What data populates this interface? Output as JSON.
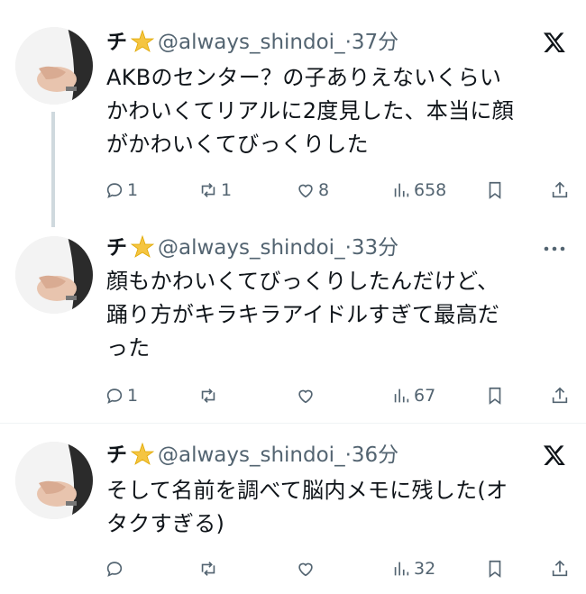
{
  "tweets": [
    {
      "name": "チ",
      "handle": "@always_shindoi_",
      "sep": "·",
      "time": "37分",
      "corner_icon": "x-logo-icon",
      "text": "AKBのセンター？の子ありえないくらいかわいくてリアルに2度見した、本当に顔がかわいくてびっくりした",
      "lines": [
        "AKBのセンター？の子ありえないくらい",
        "かわいくてリアルに2度見した、本当に顔",
        "がかわいくてびっくりした"
      ],
      "replies": "1",
      "reposts": "1",
      "likes": "8",
      "views": "658"
    },
    {
      "name": "チ",
      "handle": "@always_shindoi_",
      "sep": "·",
      "time": "33分",
      "corner_icon": "more-icon",
      "text": "顔もかわいくてびっくりしたんだけど、踊り方がキラキラアイドルすぎて最高だった",
      "lines": [
        "顔もかわいくてびっくりしたんだけど、",
        "踊り方がキラキラアイドルすぎて最高だ",
        "った"
      ],
      "replies": "1",
      "reposts": "",
      "likes": "",
      "views": "67"
    },
    {
      "name": "チ",
      "handle": "@always_shindoi_",
      "sep": "·",
      "time": "36分",
      "corner_icon": "x-logo-icon",
      "text": "そして名前を調べて脳内メモに残した(オタクすぎる)",
      "lines": [
        "そして名前を調べて脳内メモに残した(オ",
        "タクすぎる)"
      ],
      "replies": "",
      "reposts": "",
      "likes": "",
      "views": "32"
    }
  ],
  "colors": {
    "text": "#0f1419",
    "secondary": "#536471",
    "thread_line": "#cfd9de",
    "divider": "#eff3f4",
    "star": "#f5c542"
  },
  "icons": [
    "reply-icon",
    "repost-icon",
    "like-icon",
    "views-icon",
    "bookmark-icon",
    "share-icon",
    "star-emoji-icon"
  ]
}
